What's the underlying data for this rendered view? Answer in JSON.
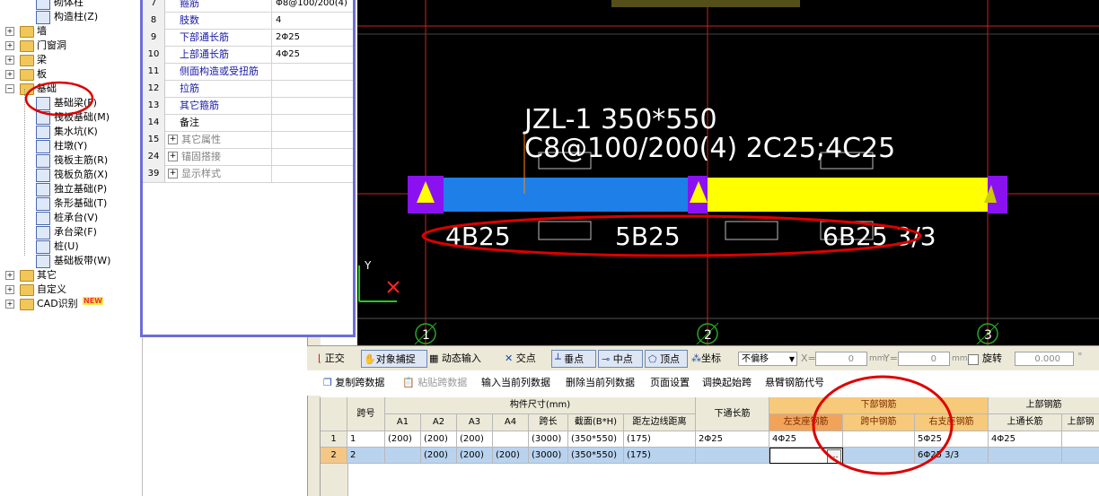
{
  "tree": {
    "items": [
      {
        "label": "砌体柱",
        "level": 2,
        "icon": "column-icon"
      },
      {
        "label": "构造柱(Z)",
        "level": 2,
        "icon": "construction-column-icon"
      },
      {
        "label": "墙",
        "level": 1,
        "icon": "folder-icon"
      },
      {
        "label": "门窗洞",
        "level": 1,
        "icon": "folder-icon"
      },
      {
        "label": "梁",
        "level": 1,
        "icon": "folder-icon"
      },
      {
        "label": "板",
        "level": 1,
        "icon": "folder-icon"
      },
      {
        "label": "基础",
        "level": 1,
        "icon": "folder-open-icon"
      },
      {
        "label": "基础梁(F)",
        "level": 2,
        "icon": "foundation-beam-icon"
      },
      {
        "label": "筏板基础(M)",
        "level": 2,
        "icon": "raft-foundation-icon"
      },
      {
        "label": "集水坑(K)",
        "level": 2,
        "icon": "sump-icon"
      },
      {
        "label": "柱墩(Y)",
        "level": 2,
        "icon": "column-pier-icon"
      },
      {
        "label": "筏板主筋(R)",
        "level": 2,
        "icon": "raft-main-rebar-icon"
      },
      {
        "label": "筏板负筋(X)",
        "level": 2,
        "icon": "raft-neg-rebar-icon"
      },
      {
        "label": "独立基础(P)",
        "level": 2,
        "icon": "isolated-footing-icon"
      },
      {
        "label": "条形基础(T)",
        "level": 2,
        "icon": "strip-footing-icon"
      },
      {
        "label": "桩承台(V)",
        "level": 2,
        "icon": "pile-cap-icon"
      },
      {
        "label": "承台梁(F)",
        "level": 2,
        "icon": "cap-beam-icon"
      },
      {
        "label": "桩(U)",
        "level": 2,
        "icon": "pile-icon"
      },
      {
        "label": "基础板带(W)",
        "level": 2,
        "icon": "foundation-strip-icon"
      },
      {
        "label": "其它",
        "level": 1,
        "icon": "folder-icon"
      },
      {
        "label": "自定义",
        "level": 1,
        "icon": "folder-icon"
      },
      {
        "label": "CAD识别",
        "level": 1,
        "icon": "folder-icon"
      }
    ],
    "new_badge": "NEW"
  },
  "props": {
    "rows": [
      {
        "num": "7",
        "name": "箍筋",
        "value": "Φ8@100/200(4)"
      },
      {
        "num": "8",
        "name": "肢数",
        "value": "4"
      },
      {
        "num": "9",
        "name": "下部通长筋",
        "value": "2Φ25"
      },
      {
        "num": "10",
        "name": "上部通长筋",
        "value": "4Φ25"
      },
      {
        "num": "11",
        "name": "侧面构造或受扭筋",
        "value": ""
      },
      {
        "num": "12",
        "name": "拉筋",
        "value": ""
      },
      {
        "num": "13",
        "name": "其它箍筋",
        "value": ""
      },
      {
        "num": "14",
        "name": "备注",
        "value": ""
      },
      {
        "num": "15",
        "name": "其它属性",
        "value": "",
        "expand": "+"
      },
      {
        "num": "24",
        "name": "锚固搭接",
        "value": "",
        "expand": "+"
      },
      {
        "num": "39",
        "name": "显示样式",
        "value": "",
        "expand": "+"
      }
    ]
  },
  "canvas": {
    "beam_label_line1": "JZL-1 350*550",
    "beam_label_line2": "C8@100/200(4) 2C25;4C25",
    "span_labels": [
      "4B25",
      "5B25",
      "6B25 3/3"
    ],
    "axis_numbers": [
      "1",
      "2",
      "3"
    ],
    "y_axis_label": "Y",
    "colors": {
      "background": "#000000",
      "span1": "#1e7fe8",
      "span2": "#ffff00",
      "support": "#8a12f0",
      "grid": "#cc2222",
      "text": "#ffffff",
      "ellipse": "#dd0000"
    }
  },
  "toolbar1": {
    "ortho": "正交",
    "snap": "对象捕捉",
    "dynamic_input": "动态输入",
    "intersection": "交点",
    "perpendicular": "垂点",
    "midpoint": "中点",
    "vertex": "顶点",
    "coordinate": "坐标",
    "offset_select": "不偏移",
    "x_label": "X=",
    "x_value": "0",
    "y_label": "Y=",
    "y_value": "0",
    "unit": "mm",
    "rotate_label": "旋转",
    "rotate_value": "0.000",
    "degree": "°"
  },
  "toolbar2": {
    "copy_span": "复制跨数据",
    "paste_span": "粘贴跨数据",
    "input_col": "输入当前列数据",
    "delete_col": "删除当前列数据",
    "page_setup": "页面设置",
    "swap_start": "调换起始跨",
    "cantilever": "悬臂钢筋代号"
  },
  "grid": {
    "headers": {
      "span_no": "跨号",
      "dims_group": "构件尺寸(mm)",
      "a1": "A1",
      "a2": "A2",
      "a3": "A3",
      "a4": "A4",
      "span_len": "跨长",
      "section": "截面(B*H)",
      "edge_dist": "距左边线距离",
      "bottom_through": "下通长筋",
      "bottom_group": "下部钢筋",
      "left_support": "左支座钢筋",
      "mid_span": "跨中钢筋",
      "right_support": "右支座钢筋",
      "top_group": "上部钢筋",
      "top_through": "上通长筋",
      "top_more": "上部钢"
    },
    "rows": [
      {
        "idx": "1",
        "span": "1",
        "a1": "(200)",
        "a2": "(200)",
        "a3": "(200)",
        "a4": "",
        "len": "(3000)",
        "section": "(350*550)",
        "edge": "(175)",
        "bottom_through": "2Φ25",
        "left": "4Φ25",
        "mid": "",
        "right": "5Φ25",
        "top_through": "4Φ25"
      },
      {
        "idx": "2",
        "span": "2",
        "a1": "",
        "a2": "(200)",
        "a3": "(200)",
        "a4": "(200)",
        "len": "(3000)",
        "section": "(350*550)",
        "edge": "(175)",
        "bottom_through": "",
        "left": "",
        "mid": "",
        "right": "6Φ25 3/3",
        "top_through": ""
      }
    ],
    "ellipsis": "…"
  }
}
